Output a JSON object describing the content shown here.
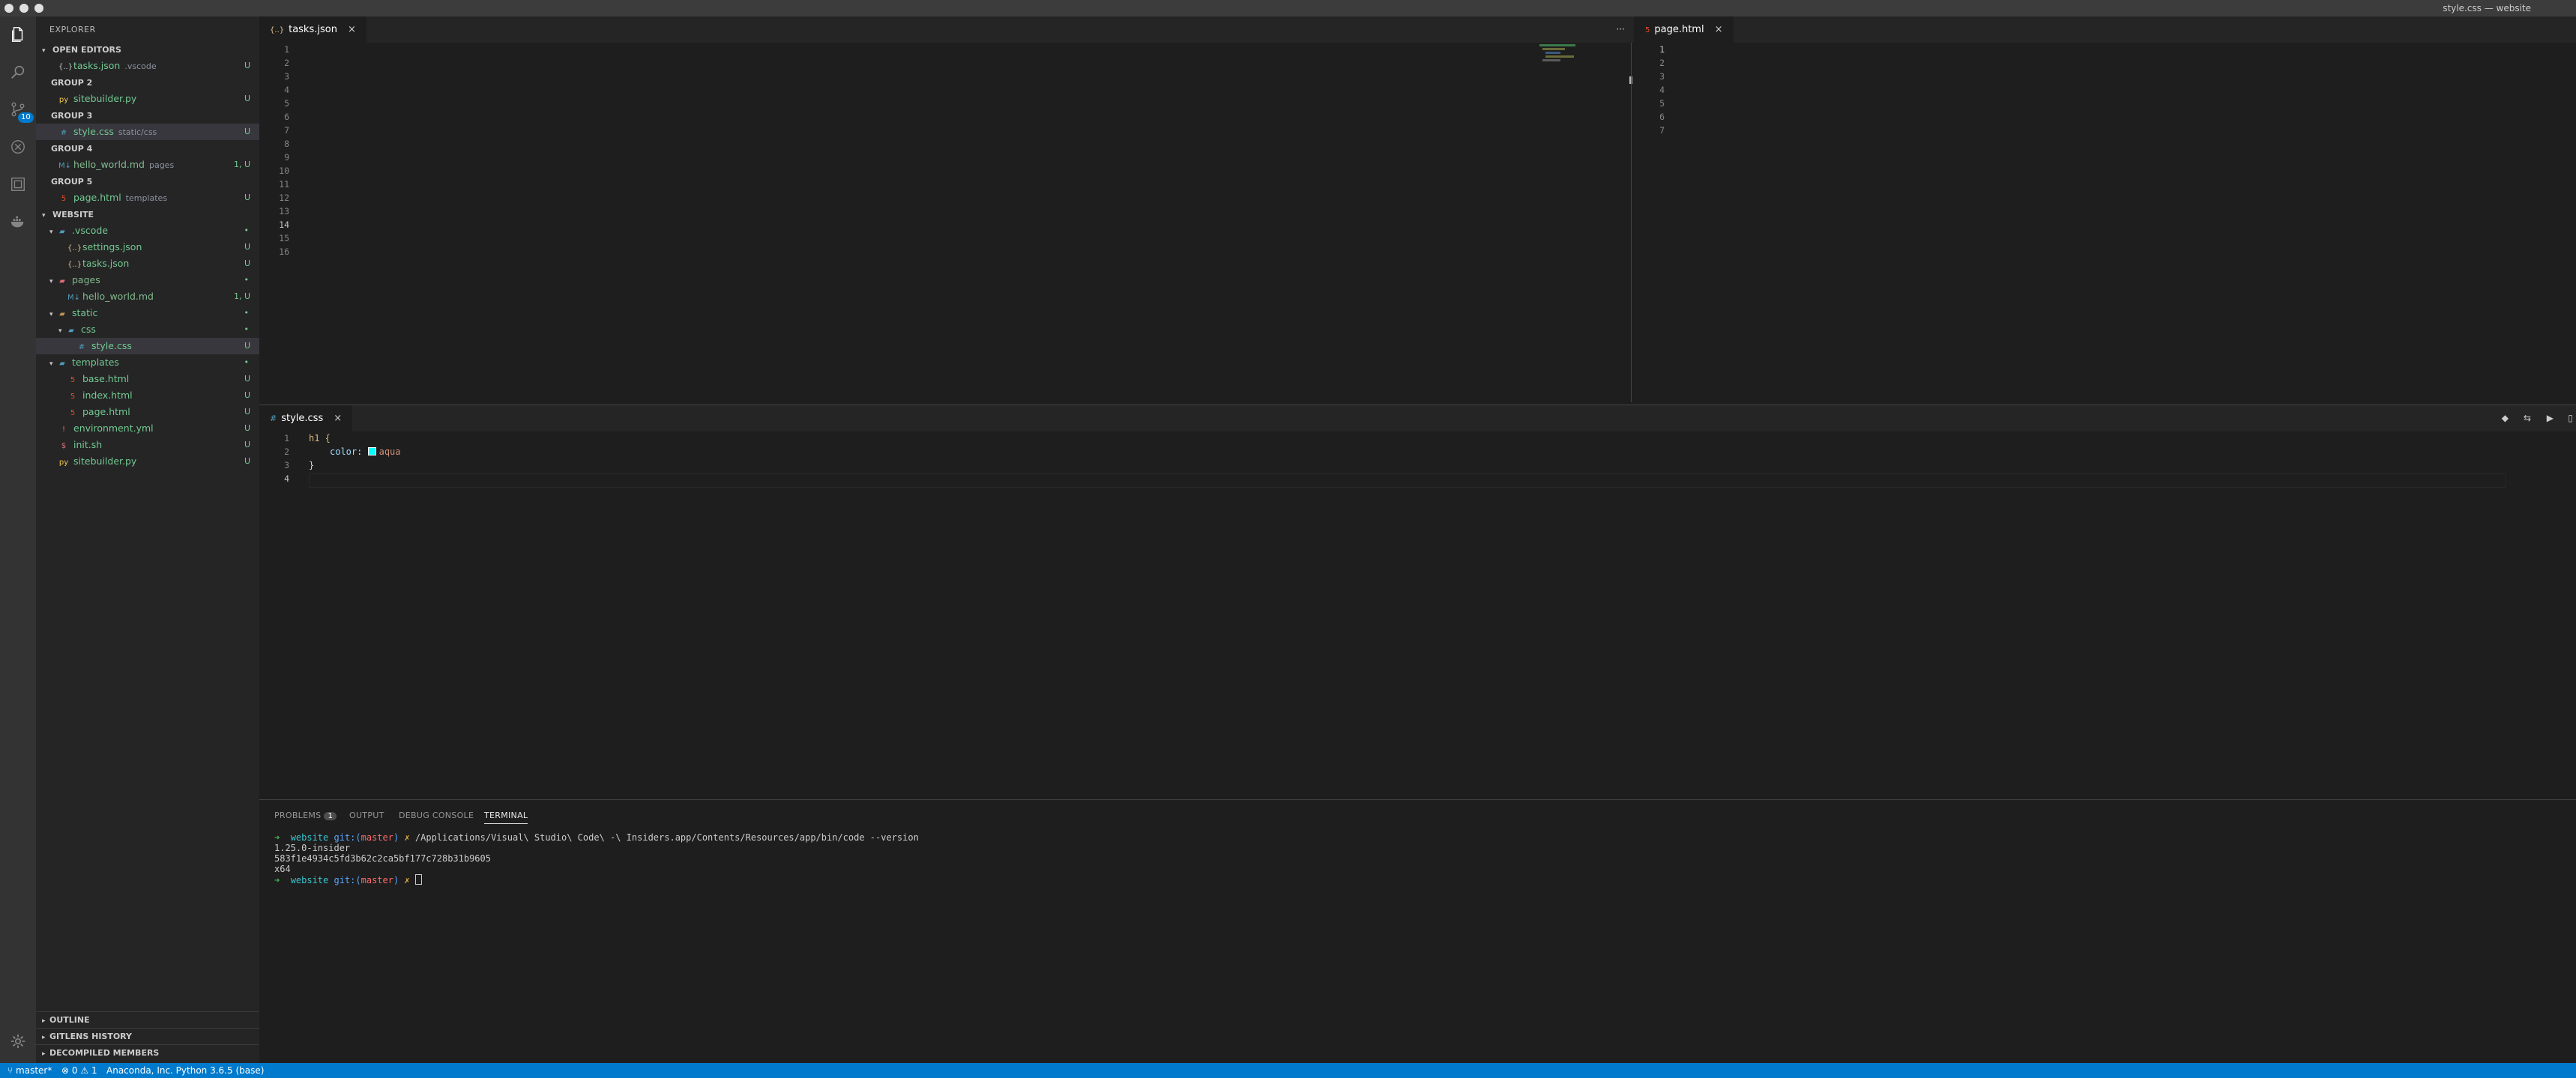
{
  "window": {
    "title": "style.css — website"
  },
  "activity": {
    "scm_badge": "10"
  },
  "sidebar": {
    "title": "EXPLORER",
    "open_editors_header": "OPEN EDITORS",
    "open_editors": [
      {
        "name": "tasks.json",
        "desc": ".vscode",
        "status": "U",
        "icon": "{..}"
      },
      {
        "group": "GROUP 2"
      },
      {
        "name": "sitebuilder.py",
        "status": "U",
        "icon": "py"
      },
      {
        "group": "GROUP 3"
      },
      {
        "name": "style.css",
        "desc": "static/css",
        "status": "U",
        "icon": "#"
      },
      {
        "group": "GROUP 4"
      },
      {
        "name": "hello_world.md",
        "desc": "pages",
        "status": "1, U",
        "icon": "M↓"
      },
      {
        "group": "GROUP 5"
      },
      {
        "name": "page.html",
        "desc": "templates",
        "status": "U",
        "icon": "5"
      }
    ],
    "website_header": "WEBSITE",
    "tree": [
      {
        "name": ".vscode",
        "status": "•",
        "icon": "folder"
      },
      {
        "name": "settings.json",
        "status": "U",
        "icon": "{..}"
      },
      {
        "name": "tasks.json",
        "status": "U",
        "icon": "{..}"
      },
      {
        "name": "pages",
        "status": "•",
        "icon": "folder"
      },
      {
        "name": "hello_world.md",
        "status": "1, U",
        "icon": "M↓"
      },
      {
        "name": "static",
        "status": "•",
        "icon": "folder"
      },
      {
        "name": "css",
        "status": "•",
        "icon": "folder"
      },
      {
        "name": "style.css",
        "status": "U",
        "icon": "#"
      },
      {
        "name": "templates",
        "status": "•",
        "icon": "folder"
      },
      {
        "name": "base.html",
        "status": "U",
        "icon": "5"
      },
      {
        "name": "index.html",
        "status": "U",
        "icon": "5"
      },
      {
        "name": "page.html",
        "status": "U",
        "icon": "5"
      },
      {
        "name": "environment.yml",
        "status": "U",
        "icon": "!"
      },
      {
        "name": "init.sh",
        "status": "U",
        "icon": "$"
      },
      {
        "name": "sitebuilder.py",
        "status": "U",
        "icon": "py"
      }
    ],
    "bottom": [
      "OUTLINE",
      "GITLENS HISTORY",
      "DECOMPILED MEMBERS"
    ]
  },
  "editor1": {
    "tab": "tasks.json",
    "icon": "{..}",
    "close": "×",
    "lines": [
      "1",
      "2",
      "3",
      "4",
      "5",
      "6",
      "7",
      "8",
      "9",
      "10",
      "11",
      "12",
      "13",
      "14",
      "15",
      "16"
    ],
    "more": "···"
  },
  "editor2": {
    "tab": "page.html",
    "icon": "5",
    "close": "×",
    "lines": [
      "1",
      "2",
      "3",
      "4",
      "5",
      "6",
      "7"
    ]
  },
  "editor3": {
    "tab": "style.css",
    "icon": "#",
    "close": "×",
    "lines": [
      "1",
      "2",
      "3",
      "4"
    ],
    "code": {
      "selector": "h1 {",
      "property": "color:",
      "value": "aqua",
      "close": "}"
    }
  },
  "panel": {
    "tabs": {
      "problems": "PROBLEMS",
      "problems_count": "1",
      "output": "OUTPUT",
      "debug": "DEBUG CONSOLE",
      "terminal": "TERMINAL"
    },
    "terminal": {
      "prompt_arrow": "➜",
      "dir": "website",
      "git": "git:(",
      "branch": "master",
      "git_close": ")",
      "mark": "✗",
      "command": "/Applications/Visual\\ Studio\\ Code\\ -\\ Insiders.app/Contents/Resources/app/bin/code --version",
      "out1": "1.25.0-insider",
      "out2": "583f1e4934c5fd3b62c2ca5bf177c728b31b9605",
      "out3": "x64"
    }
  },
  "status": {
    "branch": "master*",
    "errors": "0",
    "warnings": "1",
    "interpreter": "Anaconda, Inc. Python 3.6.5 (base)"
  }
}
